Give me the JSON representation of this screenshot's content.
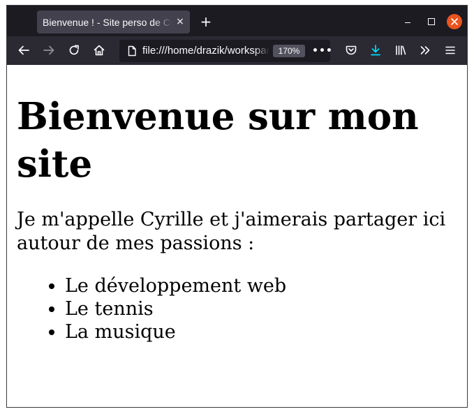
{
  "browser": {
    "tab": {
      "title": "Bienvenue ! - Site perso de Cyrille",
      "close_glyph": "×"
    },
    "new_tab_glyph": "+",
    "address": {
      "url": "file:///home/drazik/workspace",
      "zoom": "170%",
      "page_actions_glyph": "•••"
    },
    "accent_color": "#00ddff",
    "window_close_color": "#e9541f"
  },
  "page": {
    "heading": "Bienvenue sur mon site",
    "intro": "Je m'appelle Cyrille et j'aimerais partager ici autour de mes passions :",
    "passions": [
      "Le développement web",
      "Le tennis",
      "La musique"
    ]
  }
}
